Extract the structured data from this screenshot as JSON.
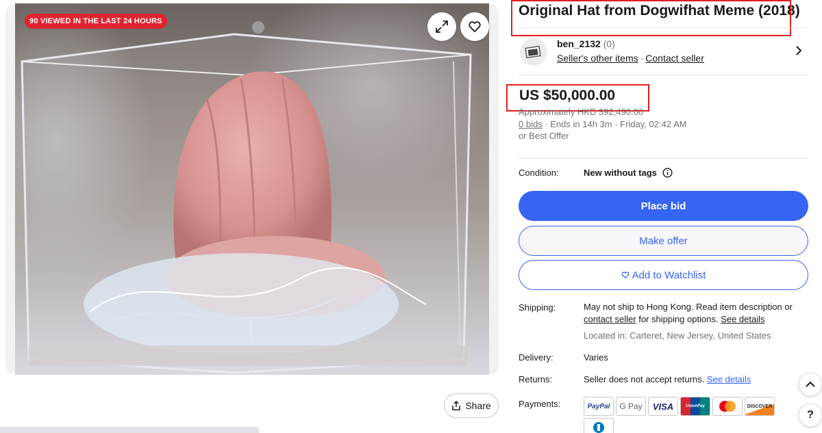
{
  "gallery": {
    "viewed_badge": "90 VIEWED IN THE LAST 24 HOURS",
    "share_label": "Share",
    "status_text": "  "
  },
  "listing": {
    "title": "Original Hat from Dogwifhat Meme (2018)",
    "seller": {
      "name": "ben_2132",
      "score": "(0)",
      "other_items": "Seller's other items",
      "contact": "Contact seller"
    },
    "price": "US $50,000.00",
    "approx": "Approximately HKD 392,490.00",
    "bids_link": "0 bids",
    "ends": " · Ends in 14h 3m · Friday, 02:42 AM",
    "best_offer": "or Best Offer",
    "condition_label": "Condition:",
    "condition_value": "New without tags",
    "buttons": {
      "place_bid": "Place bid",
      "make_offer": "Make offer",
      "watchlist": "Add to Watchlist"
    },
    "shipping_label": "Shipping:",
    "shipping_text_1": "May not ship to Hong Kong. Read item description or ",
    "shipping_contact": "contact seller",
    "shipping_text_2": " for shipping options. ",
    "shipping_details": "See details",
    "located": "Located in: Carteret, New Jersey, United States",
    "delivery_label": "Delivery:",
    "delivery_value": "Varies",
    "returns_label": "Returns:",
    "returns_value": "Seller does not accept returns. ",
    "returns_details": "See details",
    "payments_label": "Payments:",
    "payments": {
      "paypal": "PayPal",
      "gpay": "G Pay",
      "visa": "VISA",
      "unionpay": "UnionPay",
      "discover": "DISCOVER"
    },
    "help": "?"
  },
  "colors": {
    "accent": "#3665f3",
    "badge": "#e0242f",
    "highlight_box": "#e11e1e"
  }
}
